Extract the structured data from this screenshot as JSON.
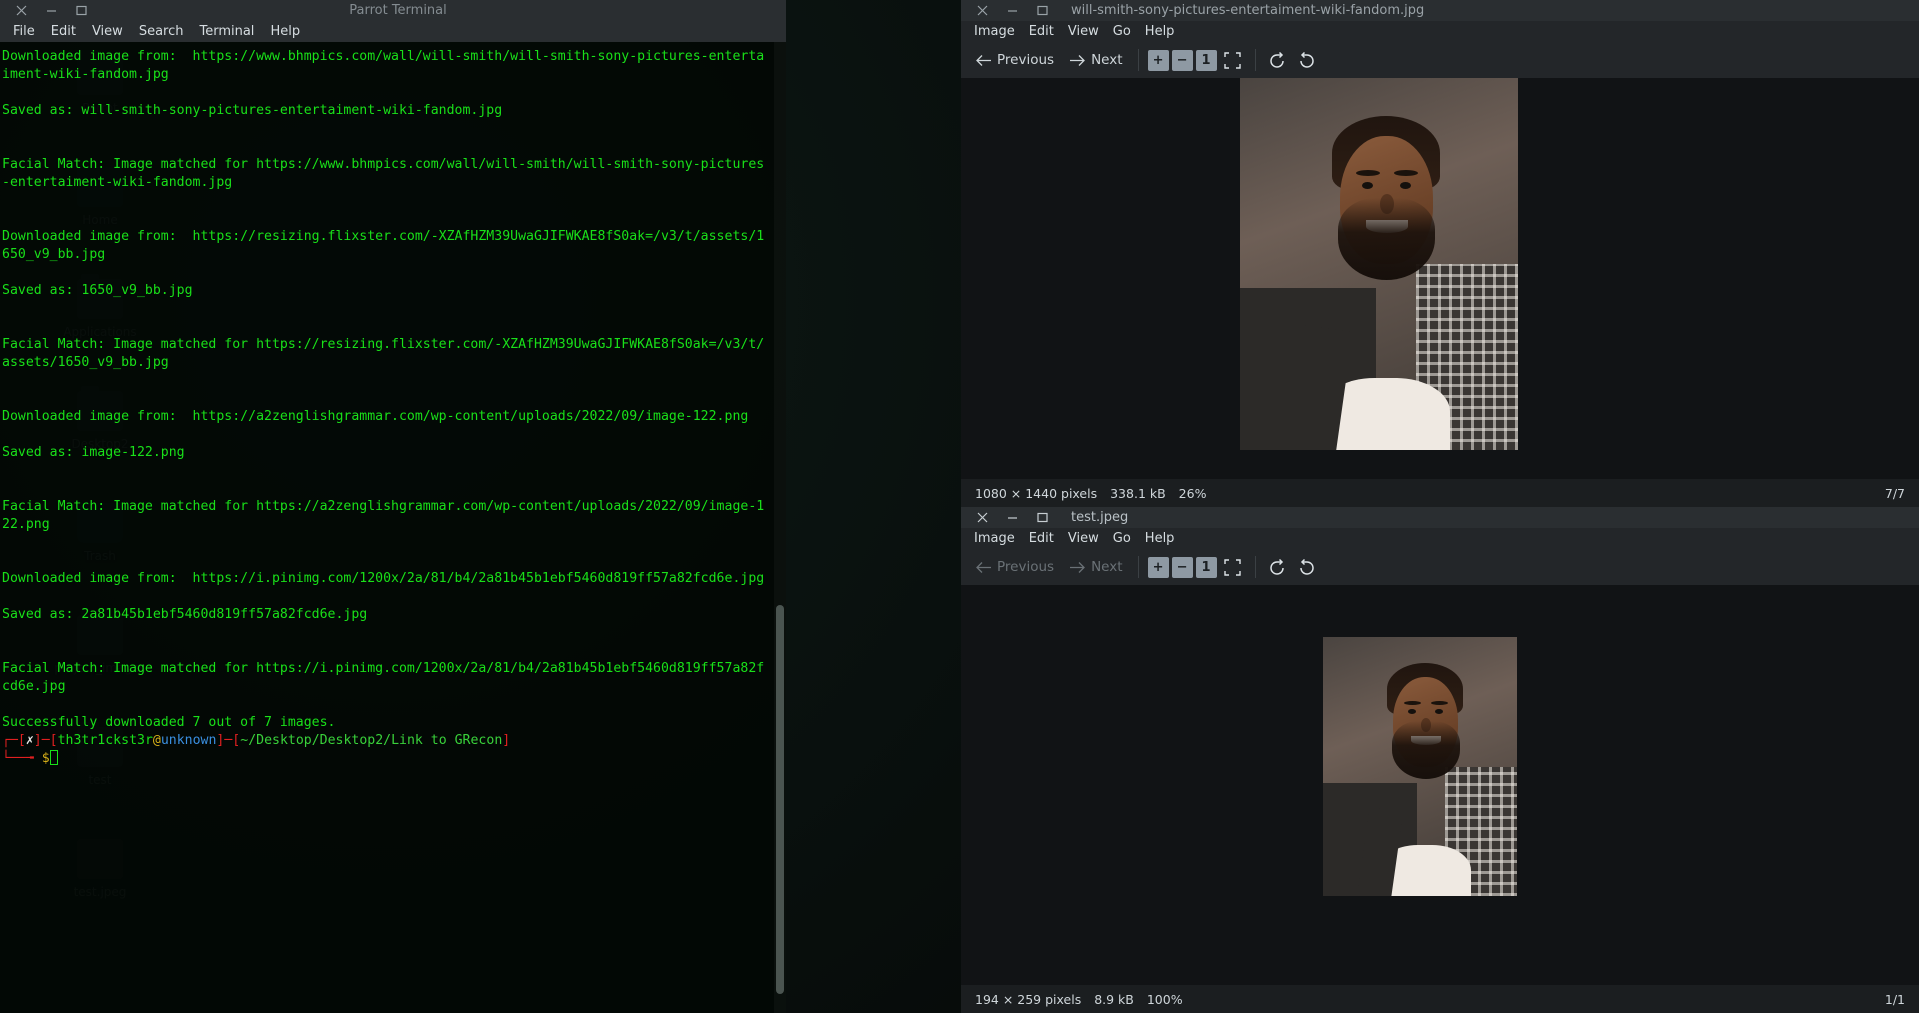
{
  "desktop": {
    "icons": [
      {
        "label": "Parrot",
        "kind": "folder"
      },
      {
        "label": "Home",
        "kind": "home"
      },
      {
        "label": "Applications",
        "kind": "folder"
      },
      {
        "label": "Desktop2",
        "kind": "folder"
      },
      {
        "label": "Trash",
        "kind": "trash"
      },
      {
        "label": "project_images",
        "kind": "folder"
      },
      {
        "label": "test",
        "kind": "folder"
      },
      {
        "label": "test.jpeg",
        "kind": "photo"
      }
    ]
  },
  "terminal": {
    "window_title": "Parrot Terminal",
    "window_buttons": {
      "close": "close-icon",
      "minimize": "minimize-icon",
      "maximize": "maximize-icon"
    },
    "menu": [
      "File",
      "Edit",
      "View",
      "Search",
      "Terminal",
      "Help"
    ],
    "output": [
      "Downloaded image from:  https://www.bhmpics.com/wall/will-smith/will-smith-sony-pictures-entertaiment-wiki-fandom.jpg",
      "",
      "Saved as: will-smith-sony-pictures-entertaiment-wiki-fandom.jpg",
      "",
      "",
      "Facial Match: Image matched for https://www.bhmpics.com/wall/will-smith/will-smith-sony-pictures-entertaiment-wiki-fandom.jpg",
      "",
      "",
      "Downloaded image from:  https://resizing.flixster.com/-XZAfHZM39UwaGJIFWKAE8fS0ak=/v3/t/assets/1650_v9_bb.jpg",
      "",
      "Saved as: 1650_v9_bb.jpg",
      "",
      "",
      "Facial Match: Image matched for https://resizing.flixster.com/-XZAfHZM39UwaGJIFWKAE8fS0ak=/v3/t/assets/1650_v9_bb.jpg",
      "",
      "",
      "Downloaded image from:  https://a2zenglishgrammar.com/wp-content/uploads/2022/09/image-122.png",
      "",
      "Saved as: image-122.png",
      "",
      "",
      "Facial Match: Image matched for https://a2zenglishgrammar.com/wp-content/uploads/2022/09/image-122.png",
      "",
      "",
      "Downloaded image from:  https://i.pinimg.com/1200x/2a/81/b4/2a81b45b1ebf5460d819ff57a82fcd6e.jpg",
      "",
      "Saved as: 2a81b45b1ebf5460d819ff57a82fcd6e.jpg",
      "",
      "",
      "Facial Match: Image matched for https://i.pinimg.com/1200x/2a/81/b4/2a81b45b1ebf5460d819ff57a82fcd6e.jpg",
      "",
      "Successfully downloaded 7 out of 7 images."
    ],
    "prompt": {
      "bracket_open": "┌",
      "dash": "─",
      "status_symbol": "✗",
      "user": "th3tr1ckst3r",
      "at": "@",
      "host": "unknown",
      "path": "~/Desktop/Desktop2/Link to GRecon",
      "second_line_prefix": "└──╼",
      "dollar": "$"
    },
    "colors": {
      "output_green": "#19e019",
      "prompt_red": "#e02020",
      "prompt_user_green": "#19e019",
      "prompt_host_blue": "#3a8fe0",
      "prompt_path_green": "#39d13a",
      "prompt_dollar_yellow": "#d8b018"
    }
  },
  "viewer_top": {
    "title": "will-smith-sony-pictures-entertaiment-wiki-fandom.jpg",
    "window_buttons": {
      "close": "close-icon",
      "minimize": "minimize-icon",
      "maximize": "maximize-icon"
    },
    "menu": [
      "Image",
      "Edit",
      "View",
      "Go",
      "Help"
    ],
    "toolbar": {
      "previous": "Previous",
      "next": "Next",
      "zoom_in": "+",
      "zoom_out": "−",
      "normal_size": "1",
      "best_fit": "best-fit-icon",
      "rotate_ccw": "rotate-counterclockwise-icon",
      "rotate_cw": "rotate-clockwise-icon",
      "prev_enabled": true,
      "next_enabled": true
    },
    "status": {
      "dimensions": "1080 × 1440 pixels",
      "filesize": "338.1 kB",
      "zoom": "26%",
      "position": "7/7"
    }
  },
  "viewer_bottom": {
    "title": "test.jpeg",
    "window_buttons": {
      "close": "close-icon",
      "minimize": "minimize-icon",
      "maximize": "maximize-icon"
    },
    "menu": [
      "Image",
      "Edit",
      "View",
      "Go",
      "Help"
    ],
    "toolbar": {
      "previous": "Previous",
      "next": "Next",
      "zoom_in": "+",
      "zoom_out": "−",
      "normal_size": "1",
      "best_fit": "best-fit-icon",
      "rotate_ccw": "rotate-counterclockwise-icon",
      "rotate_cw": "rotate-clockwise-icon",
      "prev_enabled": false,
      "next_enabled": false
    },
    "status": {
      "dimensions": "194 × 259 pixels",
      "filesize": "8.9 kB",
      "zoom": "100%",
      "position": "1/1"
    }
  }
}
